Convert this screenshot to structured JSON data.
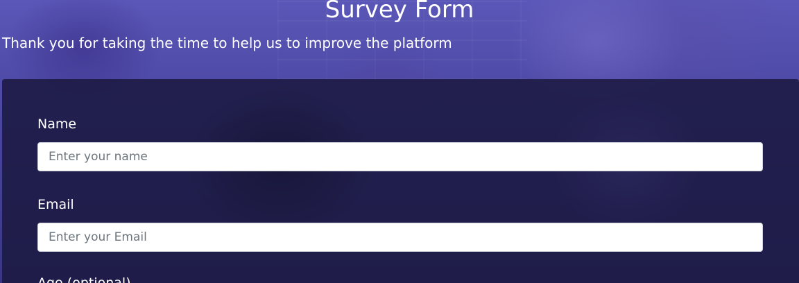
{
  "header": {
    "title": "Survey Form",
    "description": "Thank you for taking the time to help us to improve the platform"
  },
  "form": {
    "name": {
      "label": "Name",
      "placeholder": "Enter your name",
      "value": ""
    },
    "email": {
      "label": "Email",
      "placeholder": "Enter your Email",
      "value": ""
    },
    "age": {
      "label": "Age (optional)"
    }
  },
  "colors": {
    "header_overlay": "#5b57b8",
    "panel_background": "#1b1940",
    "text": "#ffffff",
    "input_background": "#ffffff",
    "placeholder": "#6c757d"
  }
}
